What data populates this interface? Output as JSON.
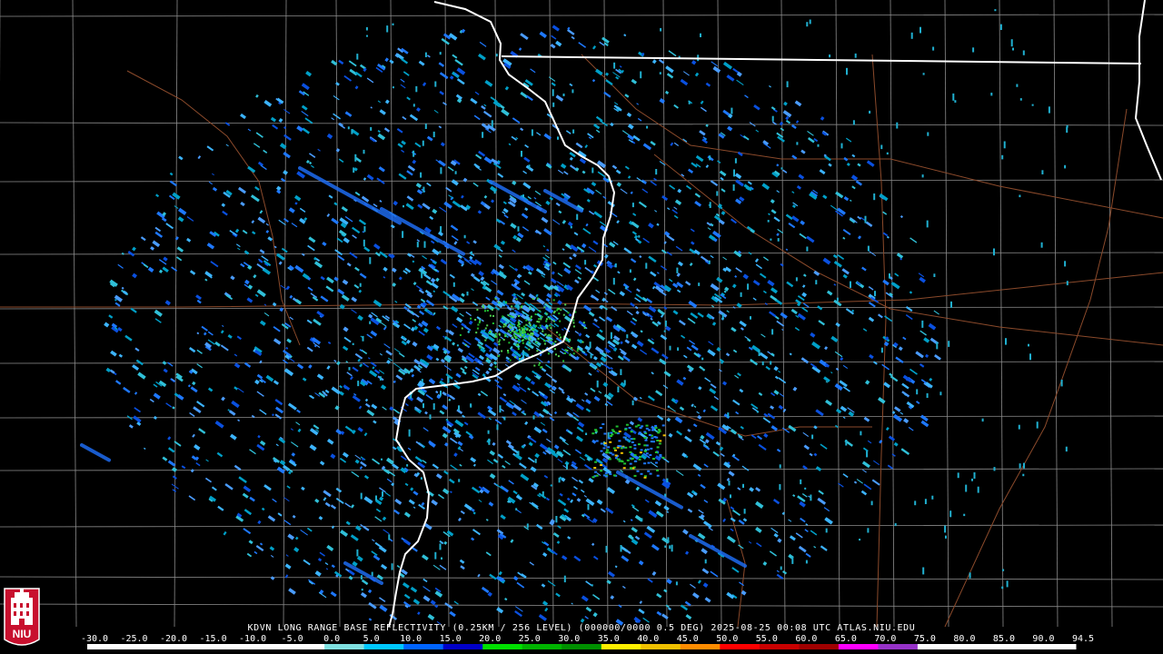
{
  "caption": "KDVN LONG RANGE BASE REFLECTIVITY (0.25KM / 256 LEVEL) (000000/0000 0.5 DEG) 2025-08-25 00:08 UTC  ATLAS.NIU.EDU",
  "logo": {
    "text": "NIU",
    "icon": "niu-tower-logo"
  },
  "colors": {
    "background": "#000000",
    "county_lines": "#8c8c8c",
    "state_lines": "#ffffff",
    "highways": "#8b4a2b",
    "logo_red": "#c8102e"
  },
  "scale": {
    "labels": [
      "-30.0",
      "-25.0",
      "-20.0",
      "-15.0",
      "-10.0",
      "-5.0",
      "0.0",
      "5.0",
      "10.0",
      "15.0",
      "20.0",
      "25.0",
      "30.0",
      "35.0",
      "40.0",
      "45.0",
      "50.0",
      "55.0",
      "60.0",
      "65.0",
      "70.0",
      "75.0",
      "80.0",
      "85.0",
      "90.0",
      "94.5"
    ],
    "colors": [
      "#ffffff",
      "#ffffff",
      "#ffffff",
      "#ffffff",
      "#ffffff",
      "#ffffff",
      "#7fe0e0",
      "#00c8ff",
      "#0064ff",
      "#0000c8",
      "#00e000",
      "#00b400",
      "#009000",
      "#fff000",
      "#f0c000",
      "#ff8c00",
      "#ff0000",
      "#c80000",
      "#a00000",
      "#ff00ff",
      "#9632c8",
      "#ffffff",
      "#ffffff",
      "#ffffff",
      "#ffffff",
      "#ffffff"
    ]
  }
}
